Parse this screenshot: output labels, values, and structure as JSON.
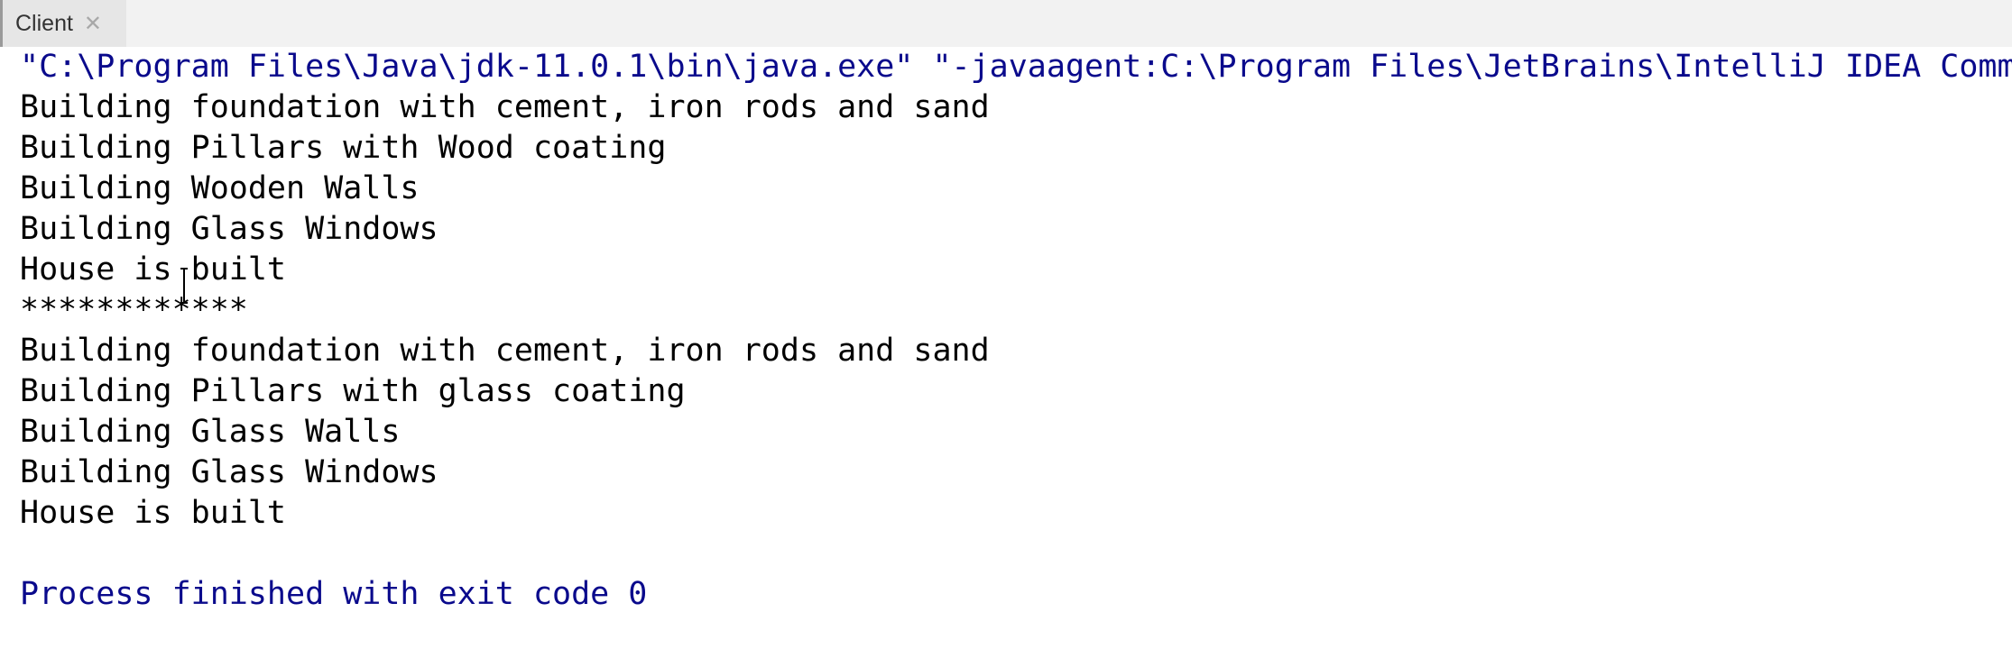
{
  "tab": {
    "label": "Client",
    "close_icon": "close-icon"
  },
  "console": {
    "command_line": "\"C:\\Program Files\\Java\\jdk-11.0.1\\bin\\java.exe\" \"-javaagent:C:\\Program Files\\JetBrains\\IntelliJ IDEA Comm",
    "output_lines": [
      "Building foundation with cement, iron rods and sand",
      "Building Pillars with Wood coating",
      "Building Wooden Walls",
      "Building Glass Windows",
      "House is built",
      "************",
      "Building foundation with cement, iron rods and sand",
      "Building Pillars with glass coating",
      "Building Glass Walls",
      "Building Glass Windows",
      "House is built"
    ],
    "exit_message": "Process finished with exit code 0"
  },
  "colors": {
    "command": "#0a0a8c",
    "output": "#000000",
    "exit": "#0a0a8c"
  }
}
